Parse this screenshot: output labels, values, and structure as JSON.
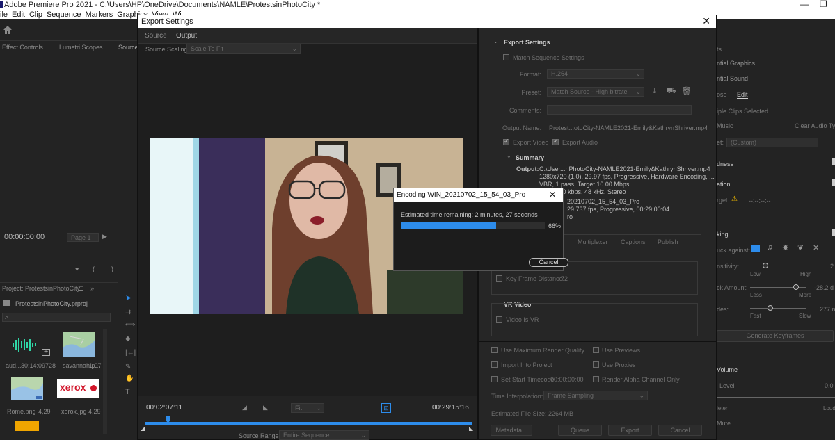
{
  "window": {
    "title": "Adobe Premiere Pro 2021 - C:\\Users\\HP\\OneDrive\\Documents\\NAMLE\\ProtestsinPhotoCity *",
    "minimize": "—",
    "restore": "❐"
  },
  "menu": [
    "ile",
    "Edit",
    "Clip",
    "Sequence",
    "Markers",
    "Graphics",
    "View",
    "Wi"
  ],
  "left_panel": {
    "tabs": [
      "Effect Controls",
      "Lumetri Scopes",
      "Source"
    ],
    "timecode": "00:00:00:00",
    "page": "Page 1",
    "project_title": "Project: ProtestsinPhotoCity",
    "project_file": "ProtestsinPhotoCity.prproj",
    "items": [
      {
        "name": "aud...",
        "info": "30:14:09728"
      },
      {
        "name": "savannah.p...",
        "info": "1,07"
      },
      {
        "name": "Rome.png",
        "info": "4,29"
      },
      {
        "name": "xerox.jpg",
        "info": "4,29"
      }
    ],
    "xerox_logo": "xerox"
  },
  "right_panel": {
    "labels": [
      "ts",
      "ntial Graphics",
      "ntial Sound",
      "ose",
      "Edit",
      "iple Clips Selected",
      "Music",
      "Clear Audio Typ",
      "et:",
      "(Custom)",
      "dness",
      "ation",
      "rget",
      "--:--:--:--",
      "king",
      "uck against:",
      "nsitivity:",
      "2",
      "Low",
      "High",
      "ck Amount:",
      "-28.2 d",
      "Less",
      "More",
      "des:",
      "277 n",
      "Fast",
      "Slow",
      "Generate Keyframes",
      "Volume",
      "Level",
      "0.0",
      "ieter",
      "Loud",
      "Mute"
    ]
  },
  "dialog": {
    "title": "Export Settings",
    "close": "✕",
    "tabs": [
      "Source",
      "Output"
    ],
    "source_scaling_label": "Source Scaling:",
    "source_scaling_value": "Scale To Fit",
    "time_in": "00:02:07:11",
    "time_out": "00:29:15:16",
    "fit_value": "Fit",
    "source_range_label": "Source Range:",
    "source_range_value": "Entire Sequence",
    "export_settings": {
      "header": "Export Settings",
      "match_sequence": "Match Sequence Settings",
      "format_label": "Format:",
      "format_value": "H.264",
      "preset_label": "Preset:",
      "preset_value": "Match Source - High bitrate",
      "comments_label": "Comments:",
      "output_name_label": "Output Name:",
      "output_name_value": "Protest...otoCity-NAMLE2021-Emily&KathrynShriver.mp4",
      "export_video": "Export Video",
      "export_audio": "Export Audio",
      "summary_header": "Summary",
      "output_label": "Output:",
      "output_lines": [
        "C:\\User...nPhotoCity-NAMLE2021-Emily&KathrynShriver.mp4",
        "1280x720 (1.0), 29.97 fps, Progressive, Hardware Encoding, ...",
        "VBR, 1 pass, Target 10.00 Mbps",
        "AAC, 320 kbps, 48 kHz, Stereo"
      ],
      "source_lines": [
        "20210702_15_54_03_Pro",
        "29.737 fps, Progressive, 00:29:00:04",
        "ro"
      ],
      "sub_tabs": [
        "Multiplexer",
        "Captions",
        "Publish"
      ],
      "key_frame_label": "Key Frame Distance:",
      "key_frame_value": "72",
      "vr_header": "VR Video",
      "video_is_vr": "Video Is VR"
    },
    "options": {
      "max_render": "Use Maximum Render Quality",
      "use_previews": "Use Previews",
      "import_project": "Import Into Project",
      "use_proxies": "Use Proxies",
      "set_start_tc": "Set Start Timecode",
      "start_tc_value": "00:00:00:00",
      "render_alpha": "Render Alpha Channel Only",
      "time_interp_label": "Time Interpolation:",
      "time_interp_value": "Frame Sampling",
      "file_size_label": "Estimated File Size:",
      "file_size_value": "2264 MB",
      "metadata_btn": "Metadata...",
      "queue_btn": "Queue",
      "export_btn": "Export",
      "cancel_btn": "Cancel"
    }
  },
  "encoding": {
    "title": "Encoding WIN_20210702_15_54_03_Pro",
    "close": "✕",
    "time_remaining": "Estimated time remaining: 2 minutes, 27 seconds",
    "progress": 0.66,
    "percent_label": "66%",
    "cancel": "Cancel"
  },
  "colors": {
    "accent": "#2d8ceb",
    "dialog_bg": "#262626",
    "warning": "#e8b400"
  }
}
